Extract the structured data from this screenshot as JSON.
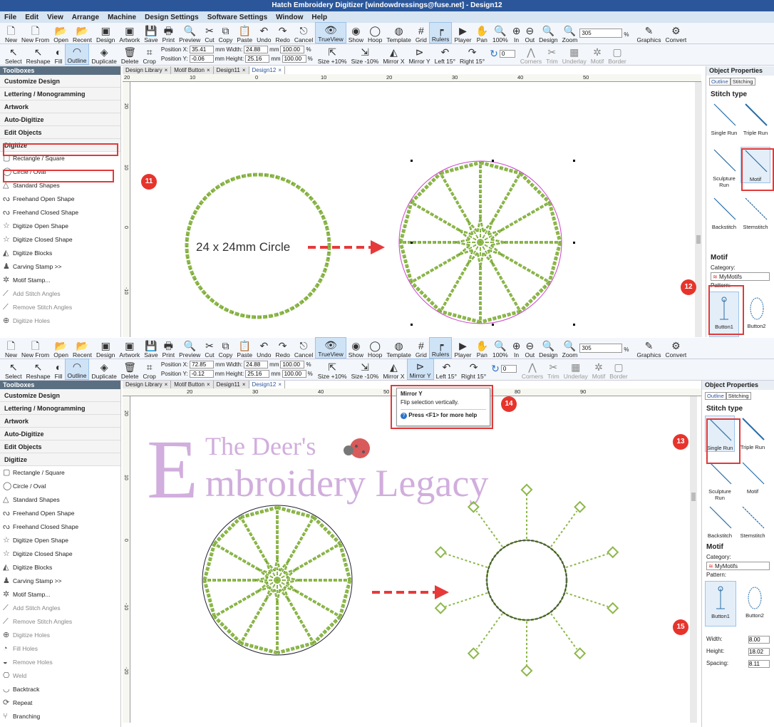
{
  "window": {
    "title": "Hatch Embroidery Digitizer [windowdressings@fuse.net] - Design12"
  },
  "menu": [
    "File",
    "Edit",
    "View",
    "Arrange",
    "Machine",
    "Design Settings",
    "Software Settings",
    "Window",
    "Help"
  ],
  "toolbar1": [
    {
      "label": "New",
      "icon": "new-icon",
      "glyph": "🗋"
    },
    {
      "label": "New From",
      "icon": "new-from-icon",
      "glyph": "🗋"
    },
    {
      "label": "Open",
      "icon": "open-icon",
      "glyph": "📂"
    },
    {
      "label": "Recent",
      "icon": "recent-icon",
      "glyph": "📂"
    },
    {
      "label": "Design",
      "icon": "design-icon",
      "glyph": "▣"
    },
    {
      "label": "Artwork",
      "icon": "artwork-icon",
      "glyph": "▣"
    },
    {
      "label": "Save",
      "icon": "save-icon",
      "glyph": "💾"
    },
    {
      "label": "Print",
      "icon": "print-icon",
      "glyph": "🖶"
    },
    {
      "label": "Preview",
      "icon": "preview-icon",
      "glyph": "🔍"
    },
    {
      "label": "Cut",
      "icon": "cut-icon",
      "glyph": "✂"
    },
    {
      "label": "Copy",
      "icon": "copy-icon",
      "glyph": "⧉"
    },
    {
      "label": "Paste",
      "icon": "paste-icon",
      "glyph": "📋"
    },
    {
      "label": "Undo",
      "icon": "undo-icon",
      "glyph": "↶"
    },
    {
      "label": "Redo",
      "icon": "redo-icon",
      "glyph": "↷"
    },
    {
      "label": "Cancel",
      "icon": "cancel-icon",
      "glyph": "⎋"
    },
    {
      "label": "TrueView",
      "icon": "trueview-icon",
      "glyph": "👁"
    },
    {
      "label": "Show",
      "icon": "show-icon",
      "glyph": "◉"
    },
    {
      "label": "Hoop",
      "icon": "hoop-icon",
      "glyph": "◯"
    },
    {
      "label": "Template",
      "icon": "template-icon",
      "glyph": "◍"
    },
    {
      "label": "Grid",
      "icon": "grid-icon",
      "glyph": "#"
    },
    {
      "label": "Rulers",
      "icon": "rulers-icon",
      "glyph": "┍"
    },
    {
      "label": "Player",
      "icon": "player-icon",
      "glyph": "▶"
    },
    {
      "label": "Pan",
      "icon": "pan-icon",
      "glyph": "✋"
    },
    {
      "label": "100%",
      "icon": "zoom-100-icon",
      "glyph": "🔍"
    },
    {
      "label": "In",
      "icon": "zoom-in-icon",
      "glyph": "⊕"
    },
    {
      "label": "Out",
      "icon": "zoom-out-icon",
      "glyph": "⊖"
    },
    {
      "label": "Design",
      "icon": "zoom-design-icon",
      "glyph": "🔍"
    },
    {
      "label": "Zoom",
      "icon": "zoom-icon",
      "glyph": "🔍"
    }
  ],
  "zoom_value": "305",
  "zoom_unit": "%",
  "toolbar1_right": [
    {
      "label": "Graphics",
      "icon": "graphics-icon",
      "glyph": "✎"
    },
    {
      "label": "Convert",
      "icon": "convert-icon",
      "glyph": "⚙"
    }
  ],
  "toolbar2": [
    {
      "label": "Select",
      "icon": "select-icon",
      "glyph": "↖"
    },
    {
      "label": "Reshape",
      "icon": "reshape-icon",
      "glyph": "↖"
    },
    {
      "label": "Fill",
      "icon": "fill-icon",
      "glyph": "◐"
    },
    {
      "label": "Outline",
      "icon": "outline-icon",
      "glyph": "◠"
    },
    {
      "label": "Duplicate",
      "icon": "duplicate-icon",
      "glyph": "◈"
    },
    {
      "label": "Delete",
      "icon": "delete-icon",
      "glyph": "🗑"
    },
    {
      "label": "Crop",
      "icon": "crop-icon",
      "glyph": "⌗"
    }
  ],
  "toolbar2_right": [
    {
      "label": "Size +10%",
      "icon": "size-up-icon",
      "glyph": "⇱"
    },
    {
      "label": "Size -10%",
      "icon": "size-down-icon",
      "glyph": "⇲"
    },
    {
      "label": "Mirror X",
      "icon": "mirror-x-icon",
      "glyph": "◭"
    },
    {
      "label": "Mirror Y",
      "icon": "mirror-y-icon",
      "glyph": "⊳"
    },
    {
      "label": "Left 15°",
      "icon": "rotate-left-icon",
      "glyph": "↶"
    },
    {
      "label": "Right 15°",
      "icon": "rotate-right-icon",
      "glyph": "↷"
    }
  ],
  "toolbar2_far": [
    {
      "label": "Corners",
      "icon": "corners-icon",
      "glyph": "⋀"
    },
    {
      "label": "Trim",
      "icon": "trim-icon",
      "glyph": "✂"
    },
    {
      "label": "Underlay",
      "icon": "underlay-icon",
      "glyph": "▦"
    },
    {
      "label": "Motif",
      "icon": "motif-icon",
      "glyph": "✲"
    },
    {
      "label": "Border",
      "icon": "border-icon",
      "glyph": "▢"
    }
  ],
  "rotate_value": "0",
  "top": {
    "position": {
      "x_label": "Position X:",
      "x": "35.41",
      "y_label": "Position Y:",
      "y": "-0.06",
      "unit": "mm"
    },
    "size": {
      "w_label": "Width:",
      "w": "24.88",
      "h_label": "Height:",
      "h": "25.16",
      "unit": "mm",
      "pw": "100.00",
      "ph": "100.00",
      "pct": "%"
    },
    "tabs": [
      "Design Library",
      "Motif Button",
      "Design11",
      "Design12"
    ],
    "ruler_ticks": [
      "20",
      "10",
      "0",
      "10",
      "20",
      "30",
      "40",
      "50"
    ],
    "vruler_ticks": [
      "20",
      "10",
      "0",
      "-10"
    ],
    "canvas_label": "24 x 24mm Circle",
    "stitch_types": [
      "Single Run",
      "Triple Run",
      "Sculpture Run",
      "Motif",
      "Backstitch",
      "Stemstitch"
    ],
    "badges": [
      "11",
      "12"
    ]
  },
  "bottom": {
    "position": {
      "x_label": "Position X:",
      "x": "72.85",
      "y_label": "Position Y:",
      "y": "-0.12",
      "unit": "mm"
    },
    "size": {
      "w_label": "Width:",
      "w": "24.88",
      "h_label": "Height:",
      "h": "25.16",
      "unit": "mm",
      "pw": "100.00",
      "ph": "100.00",
      "pct": "%"
    },
    "tabs": [
      "Design Library",
      "Motif Button",
      "Design11",
      "Design12"
    ],
    "ruler_ticks": [
      "20",
      "30",
      "40",
      "50",
      "70",
      "80",
      "90"
    ],
    "vruler_ticks": [
      "20",
      "10",
      "0",
      "-10",
      "-20"
    ],
    "tooltip": {
      "title": "Mirror Y",
      "desc": "Flip selection vertically.",
      "help": "Press <F1> for more help"
    },
    "watermark": {
      "line1": "The Deer's",
      "line2_initial": "E",
      "line2": "mbroidery Legacy"
    },
    "stitch_types": [
      "Single Run",
      "Triple Run",
      "Sculpture Run",
      "Motif",
      "Backstitch",
      "Stemstitch"
    ],
    "badges": [
      "13",
      "14",
      "15"
    ],
    "fields": [
      {
        "label": "Width:",
        "value": "8.00"
      },
      {
        "label": "Height:",
        "value": "18.02"
      },
      {
        "label": "Spacing:",
        "value": "8.11"
      }
    ]
  },
  "toolboxes": {
    "header": "Toolboxes",
    "groups": [
      "Customize Design",
      "Lettering / Monogramming",
      "Artwork",
      "Auto-Digitize",
      "Edit Objects",
      "Digitize"
    ],
    "items_top": [
      {
        "label": "Rectangle / Square",
        "icon": "rectangle-icon",
        "glyph": "▢"
      },
      {
        "label": "Circle / Oval",
        "icon": "circle-icon",
        "glyph": "◯"
      },
      {
        "label": "Standard Shapes",
        "icon": "shapes-icon",
        "glyph": "△"
      },
      {
        "label": "Freehand Open Shape",
        "icon": "freehand-open-icon",
        "glyph": "ᔓ"
      },
      {
        "label": "Freehand Closed Shape",
        "icon": "freehand-closed-icon",
        "glyph": "ᔓ"
      },
      {
        "label": "Digitize Open Shape",
        "icon": "digitize-open-icon",
        "glyph": "☆"
      },
      {
        "label": "Digitize Closed Shape",
        "icon": "digitize-closed-icon",
        "glyph": "☆"
      },
      {
        "label": "Digitize Blocks",
        "icon": "digitize-blocks-icon",
        "glyph": "◭"
      },
      {
        "label": "Carving Stamp >>",
        "icon": "carving-stamp-icon",
        "glyph": "♟"
      },
      {
        "label": "Motif Stamp...",
        "icon": "motif-stamp-icon",
        "glyph": "✲"
      },
      {
        "label": "Add Stitch Angles",
        "icon": "add-angles-icon",
        "glyph": "⟋"
      },
      {
        "label": "Remove Stitch Angles",
        "icon": "remove-angles-icon",
        "glyph": "⟋"
      },
      {
        "label": "Digitize Holes",
        "icon": "digitize-holes-icon",
        "glyph": "⊕"
      }
    ],
    "items_bottom_extra": [
      {
        "label": "Fill Holes",
        "icon": "fill-holes-icon",
        "glyph": "◔"
      },
      {
        "label": "Remove Holes",
        "icon": "remove-holes-icon",
        "glyph": "◒"
      },
      {
        "label": "Weld",
        "icon": "weld-icon",
        "glyph": "⎔"
      },
      {
        "label": "Backtrack",
        "icon": "backtrack-icon",
        "glyph": "◡"
      },
      {
        "label": "Repeat",
        "icon": "repeat-icon",
        "glyph": "⟳"
      },
      {
        "label": "Branching",
        "icon": "branching-icon",
        "glyph": "⑂"
      }
    ]
  },
  "props": {
    "header": "Object Properties",
    "tabs": [
      "Outline",
      "Stitching"
    ],
    "stitch_title": "Stitch type",
    "motif_title": "Motif",
    "category_label": "Category:",
    "category_value": "MyMotifs",
    "pattern_label": "Pattern:",
    "patterns": [
      "Button1",
      "Button2"
    ]
  },
  "colors": {
    "stitch": "#8db84a",
    "arrow": "#e63a3a",
    "selection": "#cc44cc",
    "accent": "#2b579a"
  }
}
